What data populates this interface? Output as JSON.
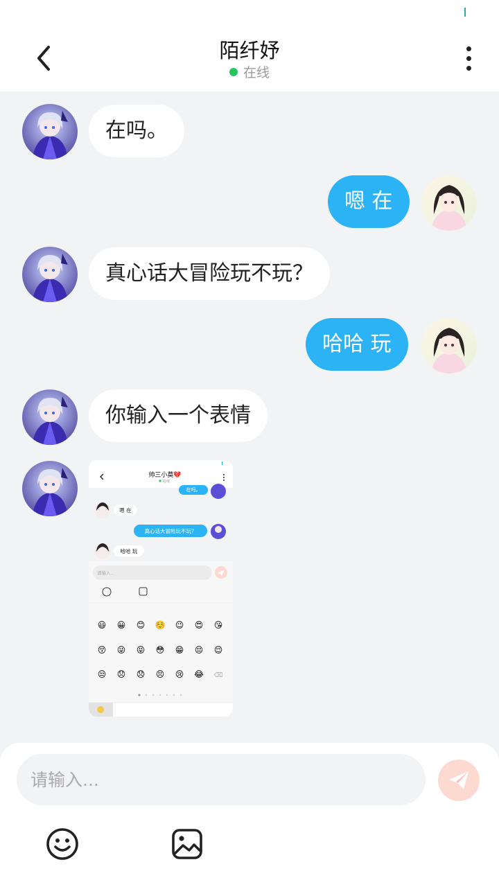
{
  "header": {
    "title": "陌纤妤",
    "status": "在线"
  },
  "messages": [
    {
      "side": "left",
      "text": "在吗。"
    },
    {
      "side": "right",
      "text": "嗯 在"
    },
    {
      "side": "left",
      "text": "真心话大冒险玩不玩？"
    },
    {
      "side": "right",
      "text": "哈哈 玩"
    },
    {
      "side": "left",
      "text": "你输入一个表情"
    },
    {
      "side": "left",
      "type": "image",
      "description": "screenshot"
    }
  ],
  "screenshot": {
    "title": "帅三小莫💔",
    "status": "在线",
    "bubbles": [
      "在吗。",
      "嗯 在",
      "真心话大冒险玩不玩？",
      "哈哈 玩"
    ],
    "input_placeholder": "请输入...",
    "emoji_rows": [
      [
        "😃",
        "😀",
        "😊",
        "☺️",
        "😉",
        "😍",
        "😘"
      ],
      [
        "😚",
        "😜",
        "😝",
        "😳",
        "😁",
        "😔",
        "😌"
      ],
      [
        "😒",
        "😞",
        "😞",
        "😣",
        "😢",
        "😂",
        "⌫"
      ]
    ]
  },
  "composer": {
    "placeholder": "请输入..."
  },
  "colors": {
    "accent": "#2bb3f5",
    "online": "#22c55e",
    "send_disabled": "#fcdad2"
  }
}
